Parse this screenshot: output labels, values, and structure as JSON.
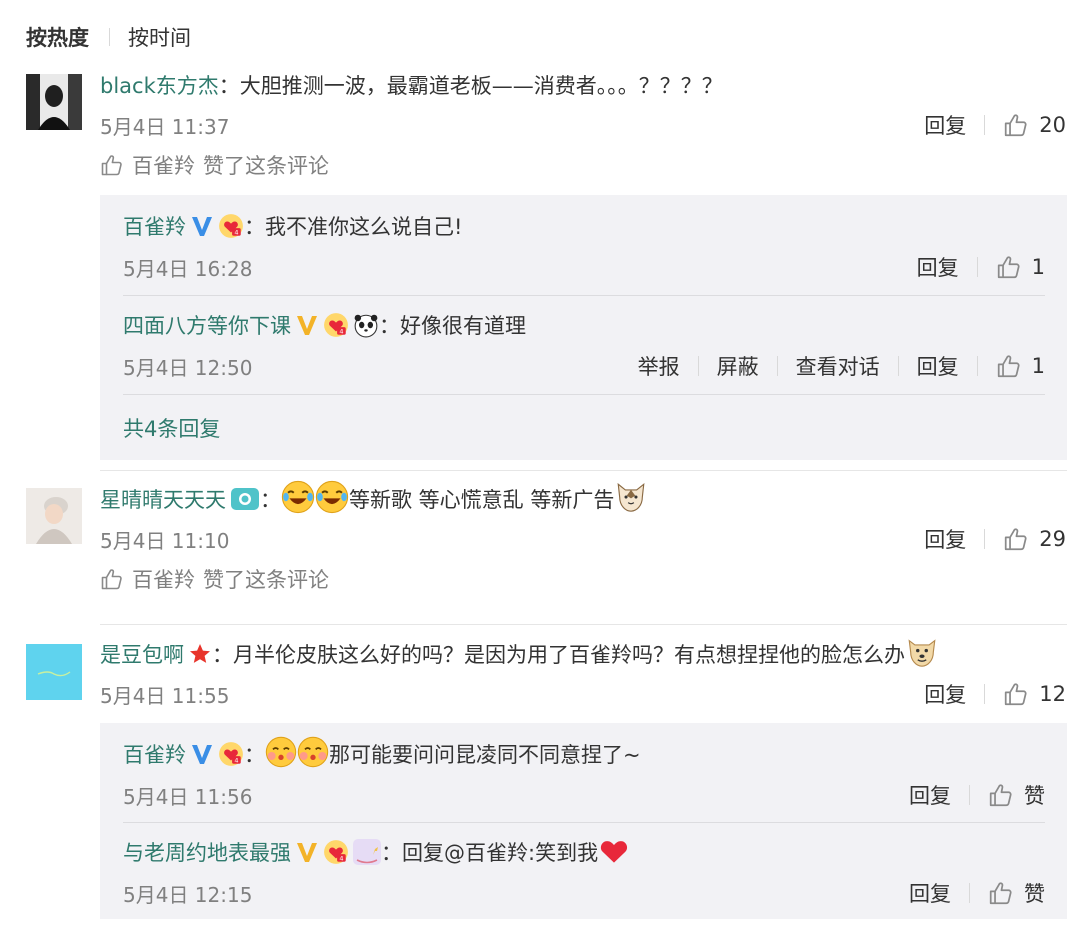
{
  "sort": {
    "hot": "按热度",
    "time": "按时间"
  },
  "actions": {
    "reply": "回复",
    "report": "举报",
    "block": "屏蔽",
    "view_dialog": "查看对话",
    "like": "赞"
  },
  "colors": {
    "username": "#2f7a6d",
    "verified_blue": "#3a8ee6",
    "verified_gold": "#f3b328",
    "reply_bg": "#f2f2f5",
    "heart": "#e8283a"
  },
  "comments": [
    {
      "user": "black东方杰",
      "text": "大胆推测一波，最霸道老板——消费者。。。？？？？",
      "time": "5月4日 11:37",
      "likes": "20",
      "liked_by": "百雀羚",
      "liked_text": "赞了这条评论",
      "replies": [
        {
          "user": "百雀羚",
          "badges": [
            "verified-blue-icon",
            "member-heart-icon"
          ],
          "text": "我不准你这么说自己!",
          "time": "5月4日 16:28",
          "likes": "1"
        },
        {
          "user": "四面八方等你下课",
          "badges": [
            "verified-gold-icon",
            "member-heart-icon",
            "panda-icon"
          ],
          "text": "好像很有道理",
          "time": "5月4日 12:50",
          "likes": "1"
        }
      ],
      "more_replies": "共4条回复"
    },
    {
      "user": "星晴晴天天天",
      "text": "等新歌 等心慌意乱 等新广告",
      "time": "5月4日 11:10",
      "likes": "29",
      "liked_by": "百雀羚",
      "liked_text": "赞了这条评论"
    },
    {
      "user": "是豆包啊",
      "text": "月半伦皮肤这么好的吗？是因为用了百雀羚吗？有点想捏捏他的脸怎么办",
      "time": "5月4日 11:55",
      "likes": "12",
      "replies": [
        {
          "user": "百雀羚",
          "badges": [
            "verified-blue-icon",
            "member-heart-icon"
          ],
          "text": "那可能要问问昆凌同不同意捏了~",
          "time": "5月4日 11:56",
          "likes": "赞"
        },
        {
          "user": "与老周约地表最强",
          "badges": [
            "verified-gold-icon",
            "member-heart-icon",
            "rocking-horse-icon"
          ],
          "text": "回复@百雀羚:笑到我",
          "time": "5月4日 12:15",
          "likes": "赞"
        }
      ]
    }
  ]
}
